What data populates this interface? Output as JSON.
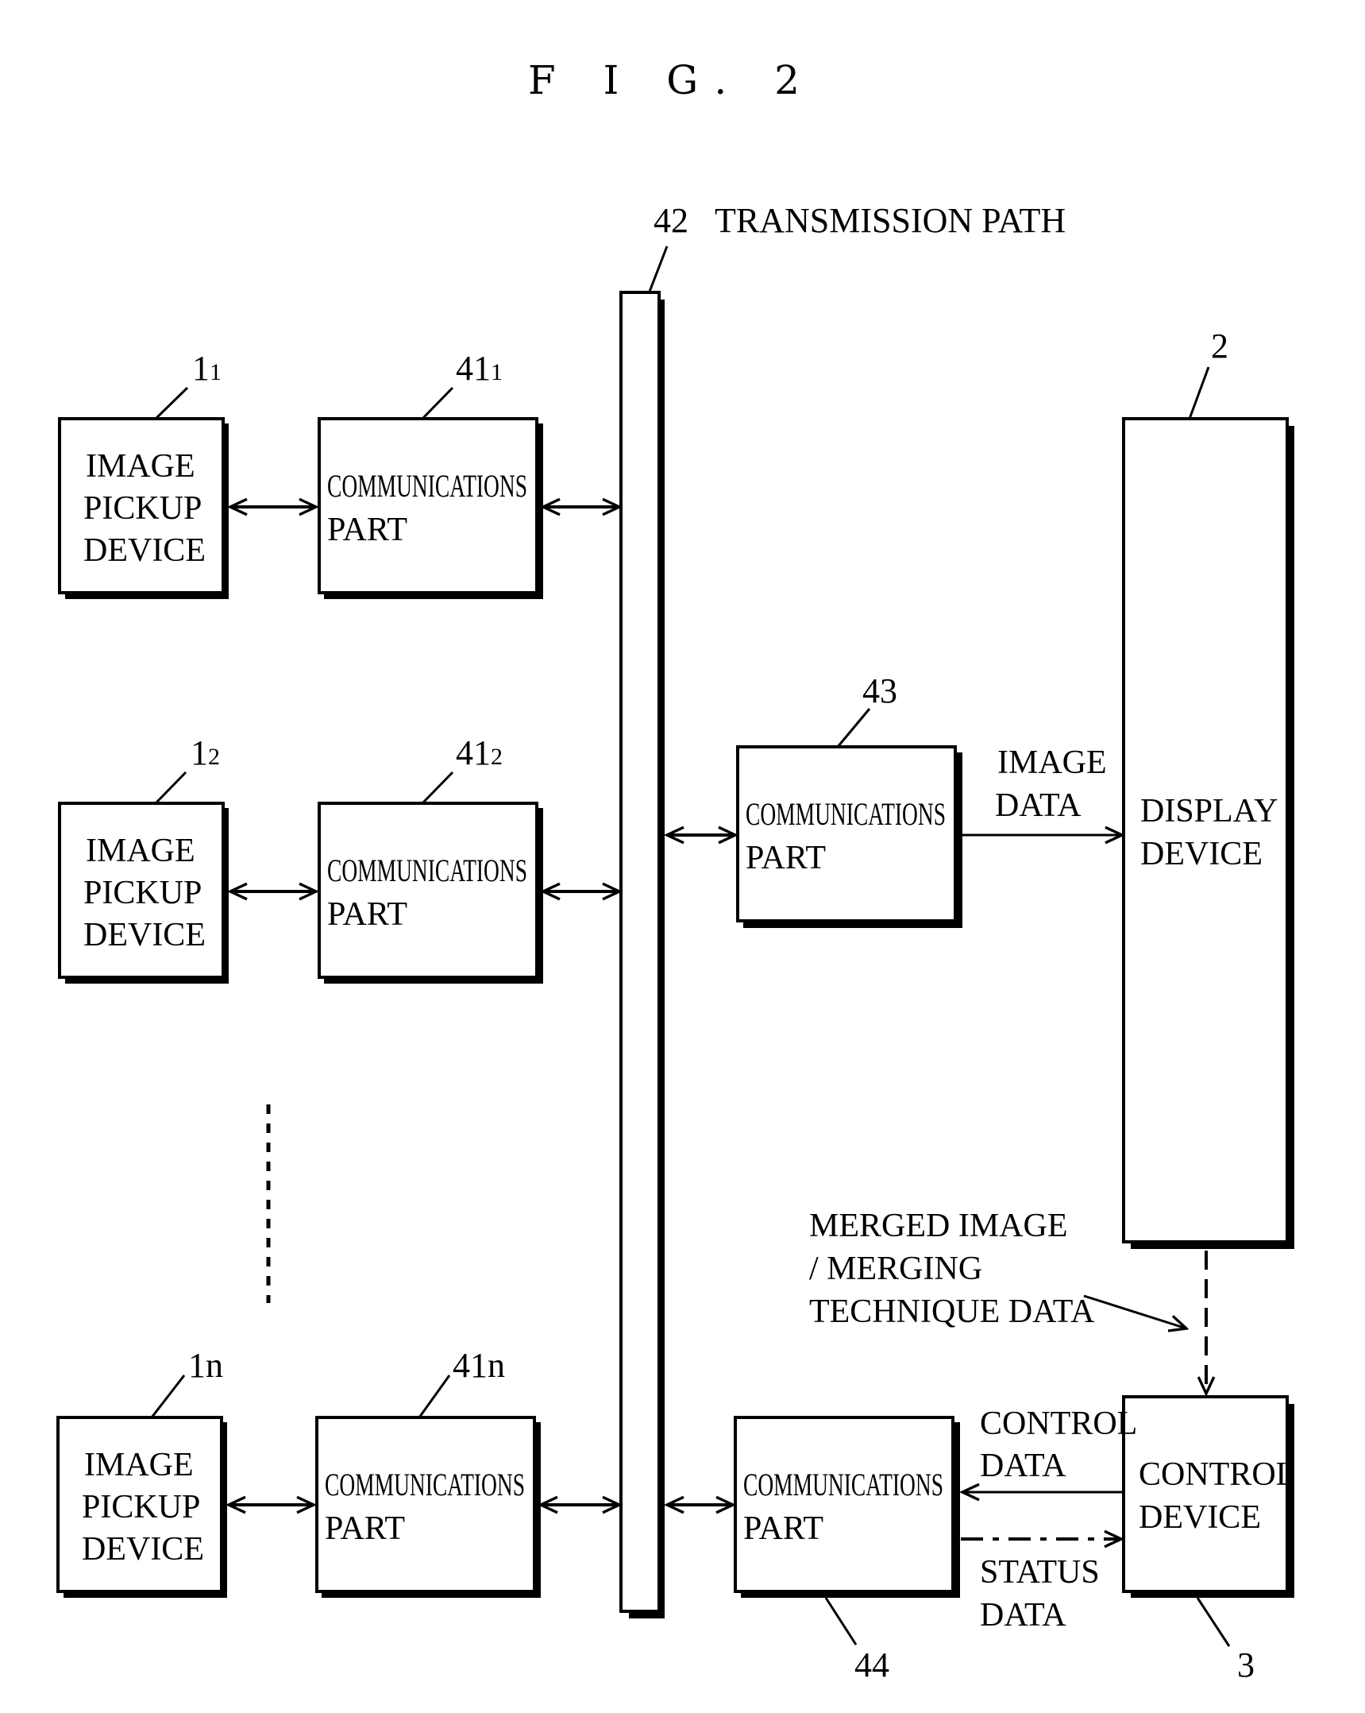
{
  "figure": {
    "title": "F I G. 2",
    "transmission_path": {
      "ref": "42",
      "label": "TRANSMISSION PATH"
    },
    "image_pickup_devices": [
      {
        "ref_main": "1",
        "ref_sub": "1",
        "lines": [
          "IMAGE",
          "PICKUP",
          "DEVICE"
        ]
      },
      {
        "ref_main": "1",
        "ref_sub": "2",
        "lines": [
          "IMAGE",
          "PICKUP",
          "DEVICE"
        ]
      },
      {
        "ref_main": "1",
        "ref_sub": "n",
        "lines": [
          "IMAGE",
          "PICKUP",
          "DEVICE"
        ]
      }
    ],
    "communication_parts_left": [
      {
        "ref_main": "41",
        "ref_sub": "1",
        "lines": [
          "COMMUNICATIONS",
          "PART"
        ]
      },
      {
        "ref_main": "41",
        "ref_sub": "2",
        "lines": [
          "COMMUNICATIONS",
          "PART"
        ]
      },
      {
        "ref_main": "41",
        "ref_sub": "n",
        "lines": [
          "COMMUNICATIONS",
          "PART"
        ]
      }
    ],
    "comm_part_43": {
      "ref": "43",
      "lines": [
        "COMMUNICATIONS",
        "PART"
      ]
    },
    "comm_part_44": {
      "ref": "44",
      "lines": [
        "COMMUNICATIONS",
        "PART"
      ]
    },
    "display_device": {
      "ref": "2",
      "lines": [
        "DISPLAY",
        "DEVICE"
      ]
    },
    "control_device": {
      "ref": "3",
      "lines": [
        "CONTROL",
        "DEVICE"
      ]
    },
    "flows": {
      "image_data": [
        "IMAGE",
        "DATA"
      ],
      "control_data": [
        "CONTROL",
        "DATA"
      ],
      "status_data": [
        "STATUS",
        "DATA"
      ],
      "merged": [
        "MERGED IMAGE",
        "/ MERGING",
        "TECHNIQUE DATA"
      ]
    }
  }
}
